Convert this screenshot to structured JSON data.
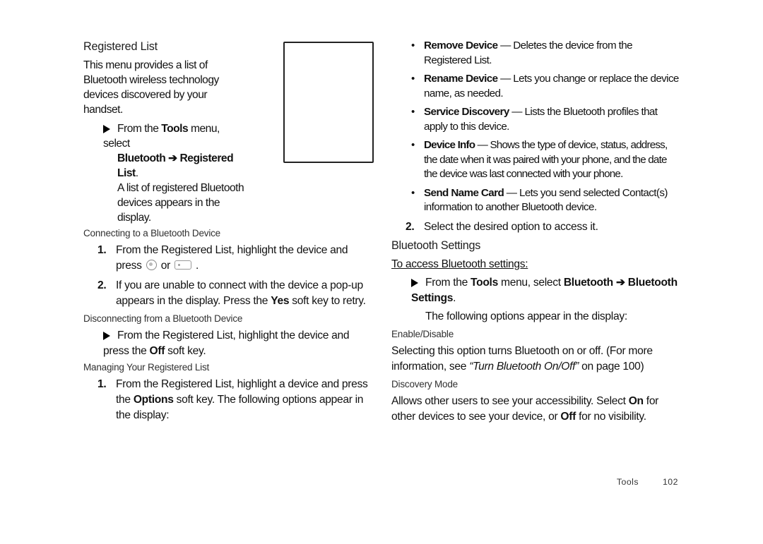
{
  "left": {
    "h_reglist": "Registered List",
    "intro": "This menu provides a list of Bluetooth wireless technology devices discovered by your handset.",
    "step_from": "From the ",
    "tools": "Tools",
    "menu_select": " menu, select ",
    "bt": "Bluetooth ",
    "arrow": "➔",
    "reglist": " Registered List",
    "period": ".",
    "listappears_a": "A list of registered Bluetooth",
    "listappears_b": "devices appears in the display.",
    "h_connect": "Connecting to a Bluetooth Device",
    "c1": "From the Registered List, highlight the device and press ",
    "or": " or ",
    "dotend": " .",
    "c2_a": "If you are unable to connect with the device a pop-up appears in the display. Press the ",
    "yes": "Yes",
    "c2_b": " soft key to retry.",
    "h_disc": "Disconnecting from a Bluetooth Device",
    "d1_a": "From the Registered List, highlight the device and press the ",
    "off": "Off",
    "d1_b": " soft key.",
    "h_manage": "Managing Your Registered List",
    "m1_a": "From the Registered List, highlight a device and press the ",
    "options": "Options",
    "m1_b": " soft key. The following options appear in the display:"
  },
  "right": {
    "opts": [
      {
        "t": "Remove Device",
        "d": " — Deletes the device from the Registered List."
      },
      {
        "t": "Rename Device",
        "d": " — Lets you change or replace the device name, as needed."
      },
      {
        "t": "Service Discovery",
        "d": " — Lists the Bluetooth profiles that apply to this device."
      },
      {
        "t": "Device Info",
        "d": " — Shows the type of device, status, address, the date when it was paired with your phone, and the date the device was last connected with your phone."
      },
      {
        "t": "Send Name Card",
        "d": " — Lets you send selected Contact(s) information to another Bluetooth device."
      }
    ],
    "sel": "Select the desired option to access it.",
    "h_bt_settings": "Bluetooth Settings",
    "access": "To access Bluetooth settings:",
    "s_from": "From the ",
    "tools": "Tools",
    "menu_select": " menu, select ",
    "bt": "Bluetooth ",
    "arrow": "➔",
    "bt2": " Bluetooth Settings",
    "period": ".",
    "follow": "The following options appear in the display:",
    "h_enable": "Enable/Disable",
    "enable_a": "Selecting this option turns Bluetooth on or off. (For more information, see ",
    "enable_i": "“Turn Bluetooth On/Off”",
    "enable_b": " on page 100)",
    "h_disc": "Discovery Mode",
    "disc_a": "Allows other users to see your accessibility. Select ",
    "on": "On",
    "disc_b": " for other devices to see your device, or ",
    "off": "Off",
    "disc_c": " for no visibility."
  },
  "footer": {
    "section": "Tools",
    "page": "102"
  }
}
